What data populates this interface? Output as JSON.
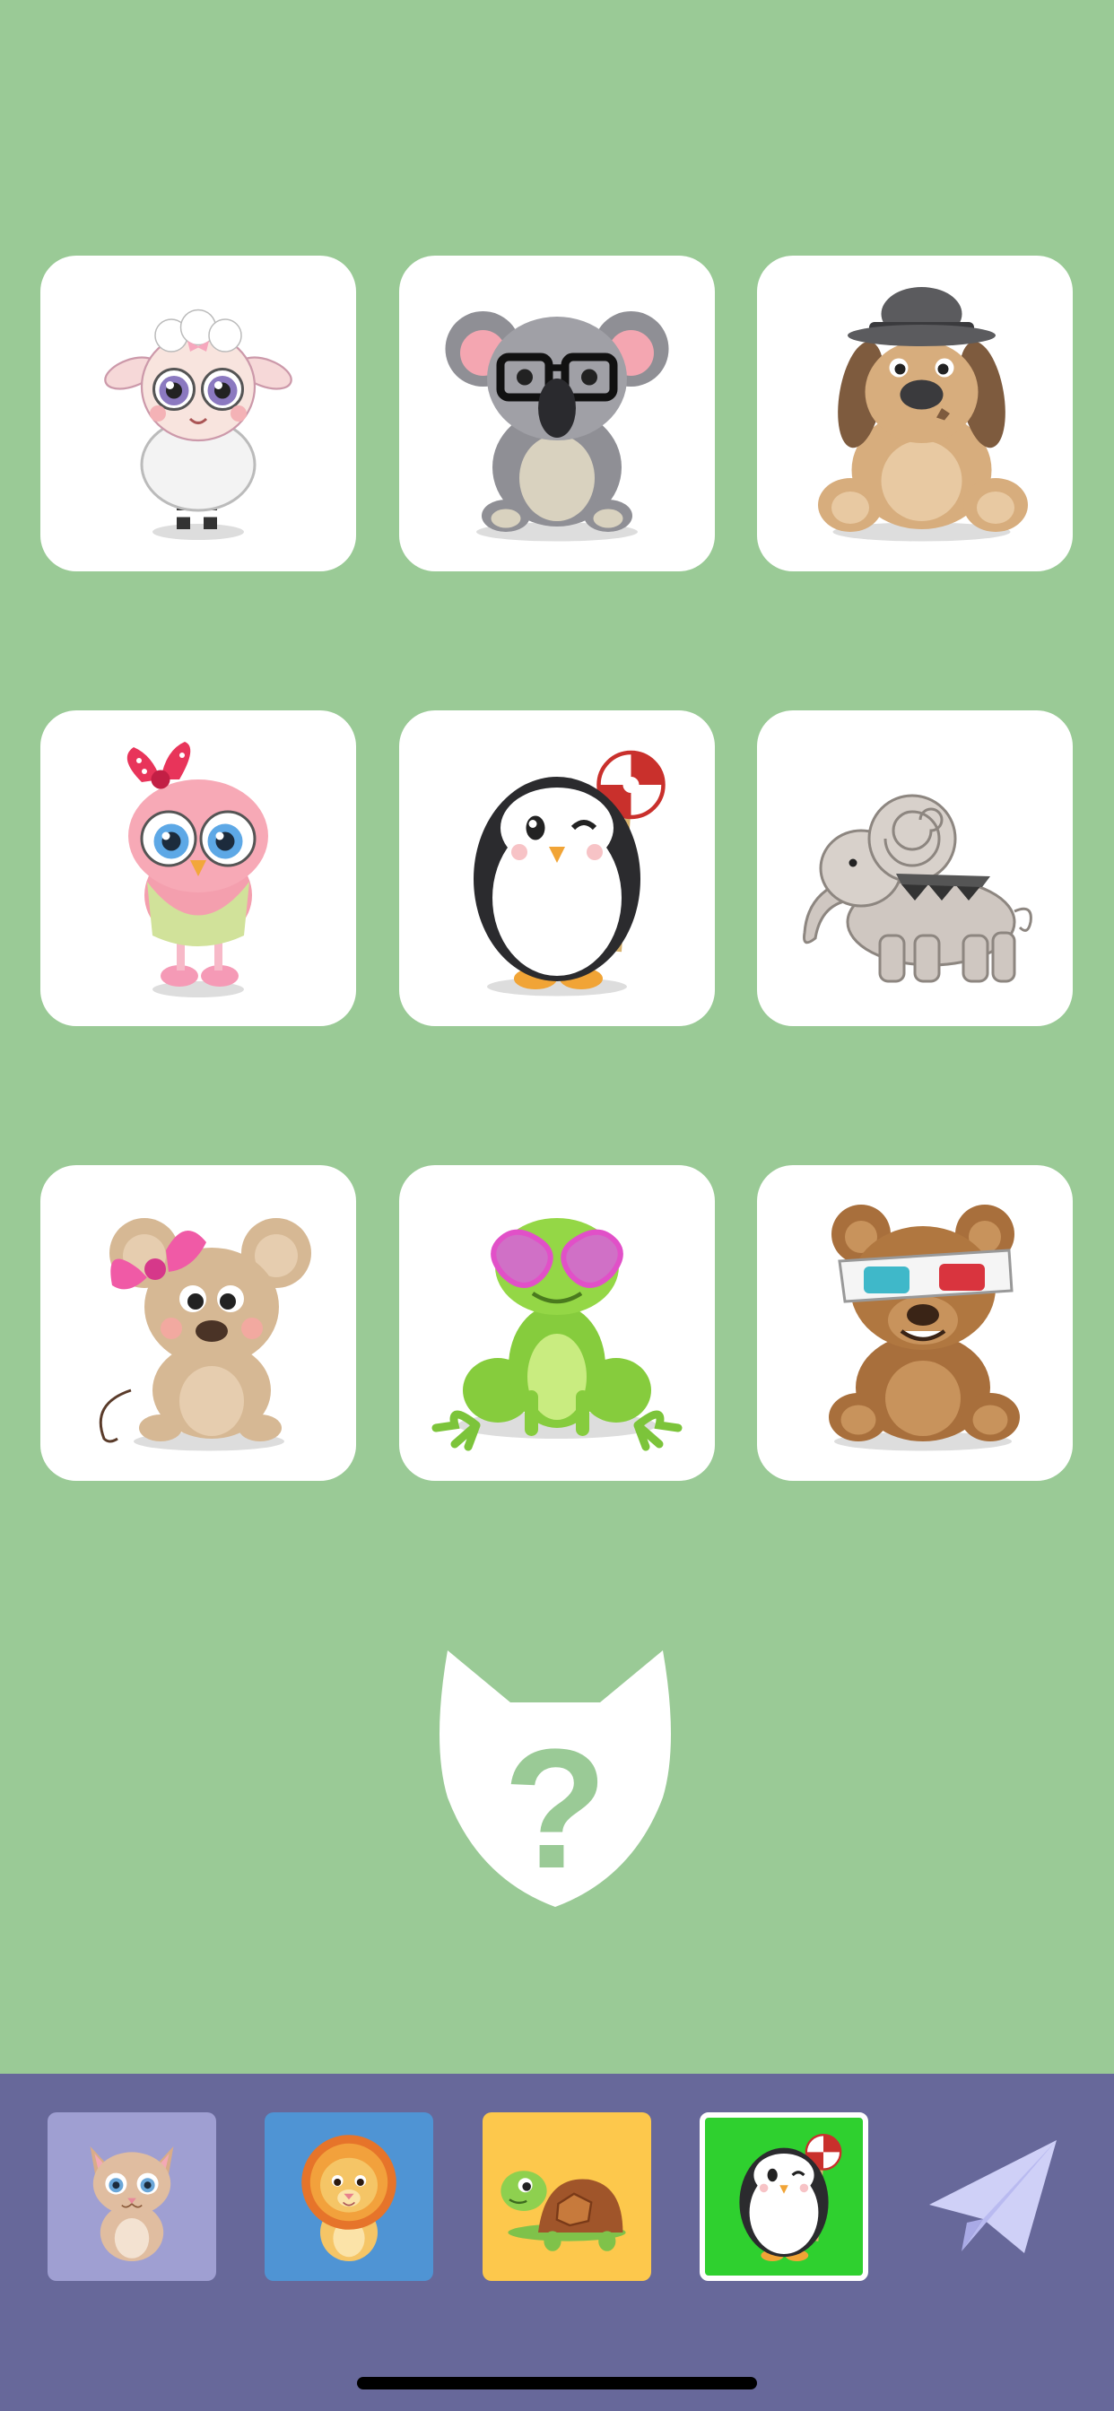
{
  "app": {
    "background_color": "#9aca96",
    "grid": {
      "animals": [
        {
          "name": "sheep",
          "icon": "sheep-icon"
        },
        {
          "name": "koala",
          "icon": "koala-icon"
        },
        {
          "name": "dog",
          "icon": "dog-icon"
        },
        {
          "name": "owl",
          "icon": "owl-icon"
        },
        {
          "name": "penguin",
          "icon": "penguin-icon"
        },
        {
          "name": "elephant",
          "icon": "elephant-icon"
        },
        {
          "name": "mouse",
          "icon": "mouse-icon"
        },
        {
          "name": "frog",
          "icon": "frog-icon"
        },
        {
          "name": "bear",
          "icon": "bear-icon"
        }
      ]
    },
    "mystery": {
      "icon": "mystery-fox-question-icon",
      "glyph": "?"
    },
    "bottom_bar": {
      "background_color": "#67689a",
      "slots": [
        {
          "name": "cat",
          "icon": "cat-icon",
          "background": "#9f9fd2",
          "selected": false
        },
        {
          "name": "lion",
          "icon": "lion-icon",
          "background": "#4f94d4",
          "selected": false
        },
        {
          "name": "turtle",
          "icon": "turtle-icon",
          "background": "#fdc84c",
          "selected": false
        },
        {
          "name": "penguin",
          "icon": "penguin-icon",
          "background": "#2fd02f",
          "selected": true
        }
      ],
      "send_icon": "paper-plane-icon"
    }
  }
}
